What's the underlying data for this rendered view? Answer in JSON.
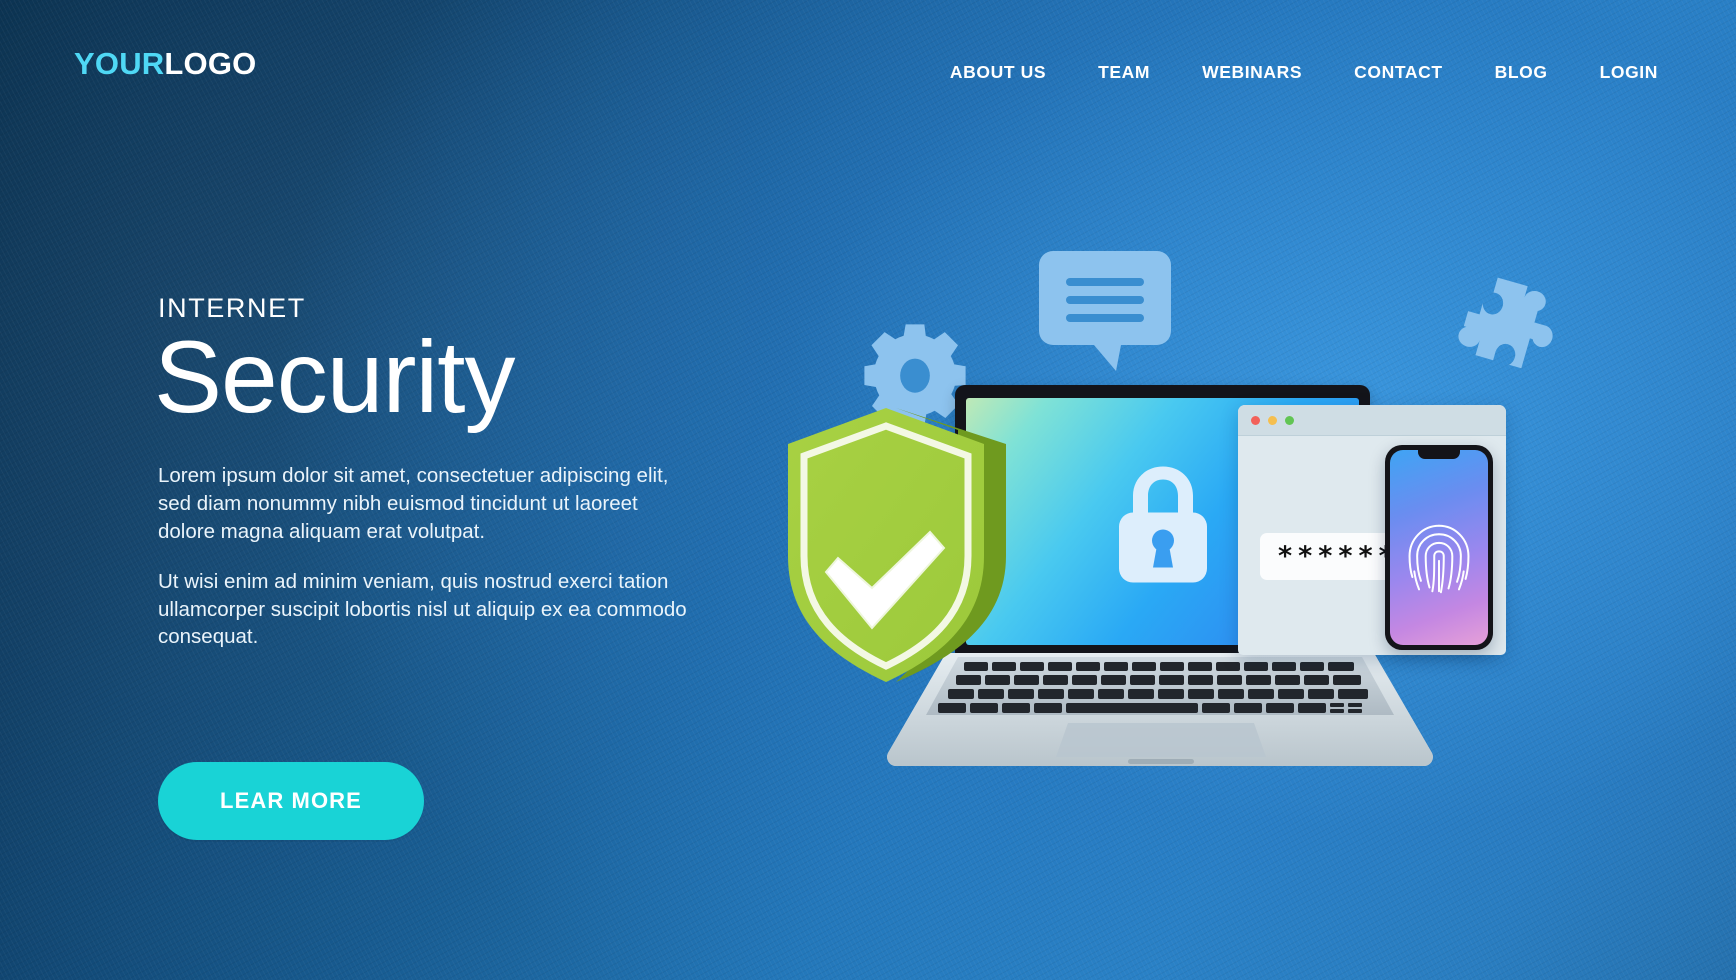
{
  "brand": {
    "logo_part1": "YOUR",
    "logo_part2": "LOGO",
    "accent_cyan": "#4fd8f5",
    "button_color": "#19d3d6",
    "shield_green": "#9ec93a"
  },
  "nav": {
    "items": [
      {
        "label": "ABOUT US"
      },
      {
        "label": "TEAM"
      },
      {
        "label": "WEBINARS"
      },
      {
        "label": "CONTACT"
      },
      {
        "label": "BLOG"
      },
      {
        "label": "LOGIN"
      }
    ]
  },
  "hero": {
    "eyebrow": "INTERNET",
    "headline": "Security",
    "paragraph_1": "Lorem ipsum dolor sit amet, consectetuer adipiscing elit, sed diam nonummy nibh euismod tincidunt ut laoreet dolore magna aliquam erat volutpat.",
    "paragraph_2": "Ut wisi enim ad minim veniam, quis nostrud exerci tation ullamcorper suscipit lobortis nisl ut aliquip ex ea commodo consequat.",
    "cta_label": "LEAR MORE"
  },
  "illustration": {
    "icons": [
      {
        "name": "gear-icon"
      },
      {
        "name": "chat-bubble-icon"
      },
      {
        "name": "puzzle-piece-icon"
      },
      {
        "name": "padlock-icon"
      },
      {
        "name": "shield-check-icon"
      },
      {
        "name": "fingerprint-icon"
      }
    ],
    "browser_window": {
      "traffic_lights": [
        "#f2615a",
        "#f5bf4f",
        "#62c554"
      ],
      "password_value": "******"
    }
  }
}
